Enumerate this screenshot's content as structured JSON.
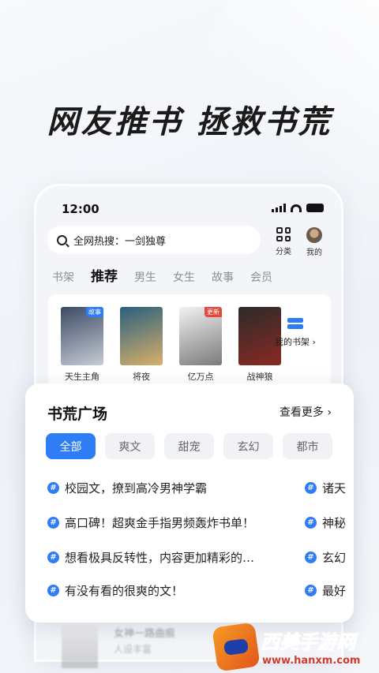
{
  "headline": "网友推书 拯救书荒",
  "phone": {
    "time": "12:00",
    "search_placeholder": "全网热搜：一剑独尊",
    "category_label": "分类",
    "mine_label": "我的",
    "tabs": [
      "书架",
      "推荐",
      "男生",
      "女生",
      "故事",
      "会员"
    ],
    "books": [
      {
        "title": "天生主角肆",
        "tag": "故事",
        "tag_color": "#2f7df6",
        "cover_colors": [
          "#3b4a63",
          "#c7ccd6"
        ]
      },
      {
        "title": "将夜",
        "tag": "",
        "tag_color": "",
        "cover_colors": [
          "#2a5f7e",
          "#d8b06a"
        ]
      },
      {
        "title": "亿万点击…",
        "tag": "更新",
        "tag_color": "#e4483a",
        "cover_colors": [
          "#f2f2f2",
          "#7a7a7a"
        ]
      },
      {
        "title": "战神狼",
        "tag": "",
        "tag_color": "",
        "cover_colors": [
          "#2b2b2b",
          "#8a2a22"
        ]
      }
    ],
    "shelf_label": "我的书架 ›"
  },
  "card": {
    "title": "书荒广场",
    "more": "查看更多 ›",
    "chips": [
      "全部",
      "爽文",
      "甜宠",
      "玄幻",
      "都市"
    ],
    "topics": [
      "校园文，撩到高冷男神学霸",
      "高口碑！超爽金手指男频轰炸书单！",
      "想看极具反转性，内容更加精彩的…",
      "有没有看的很爽的文！"
    ],
    "topics_right": [
      "诸天",
      "神秘",
      "玄幻",
      "最好"
    ]
  },
  "peek": {
    "title": "女神一路曲痕",
    "author": "人设丰富"
  },
  "watermark": {
    "name": "西美手游网",
    "url": "www.hanxm.com"
  }
}
